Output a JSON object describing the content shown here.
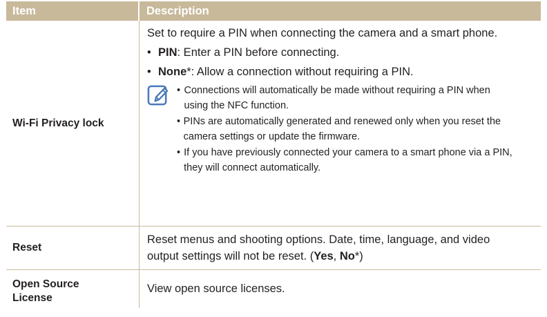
{
  "header": {
    "item": "Item",
    "description": "Description"
  },
  "rows": [
    {
      "item": "Wi-Fi Privacy lock",
      "intro": "Set to require a PIN when connecting the camera and a smart phone.",
      "options": [
        {
          "name": "PIN",
          "text": ": Enter a PIN before connecting."
        },
        {
          "name": "None",
          "text": "*: Allow a connection without requiring a PIN."
        }
      ],
      "note_icon": "note-pencil-icon",
      "notes": [
        "Connections will automatically be made without requiring a PIN when using the NFC function.",
        "PINs are automatically generated and renewed only when you reset the camera settings or update the firmware.",
        "If you have previously connected your camera to a smart phone via a PIN, they will connect automatically."
      ]
    },
    {
      "item": "Reset",
      "text": "Reset menus and shooting options. Date, time, language, and video output settings will not be reset. (",
      "yes": "Yes",
      "sep": ", ",
      "no": "No",
      "end": "*)"
    },
    {
      "item": "Open Source License",
      "text": "View open source licenses."
    }
  ],
  "colors": {
    "header_bg": "#c8b99b",
    "icon": "#4a79b8"
  }
}
